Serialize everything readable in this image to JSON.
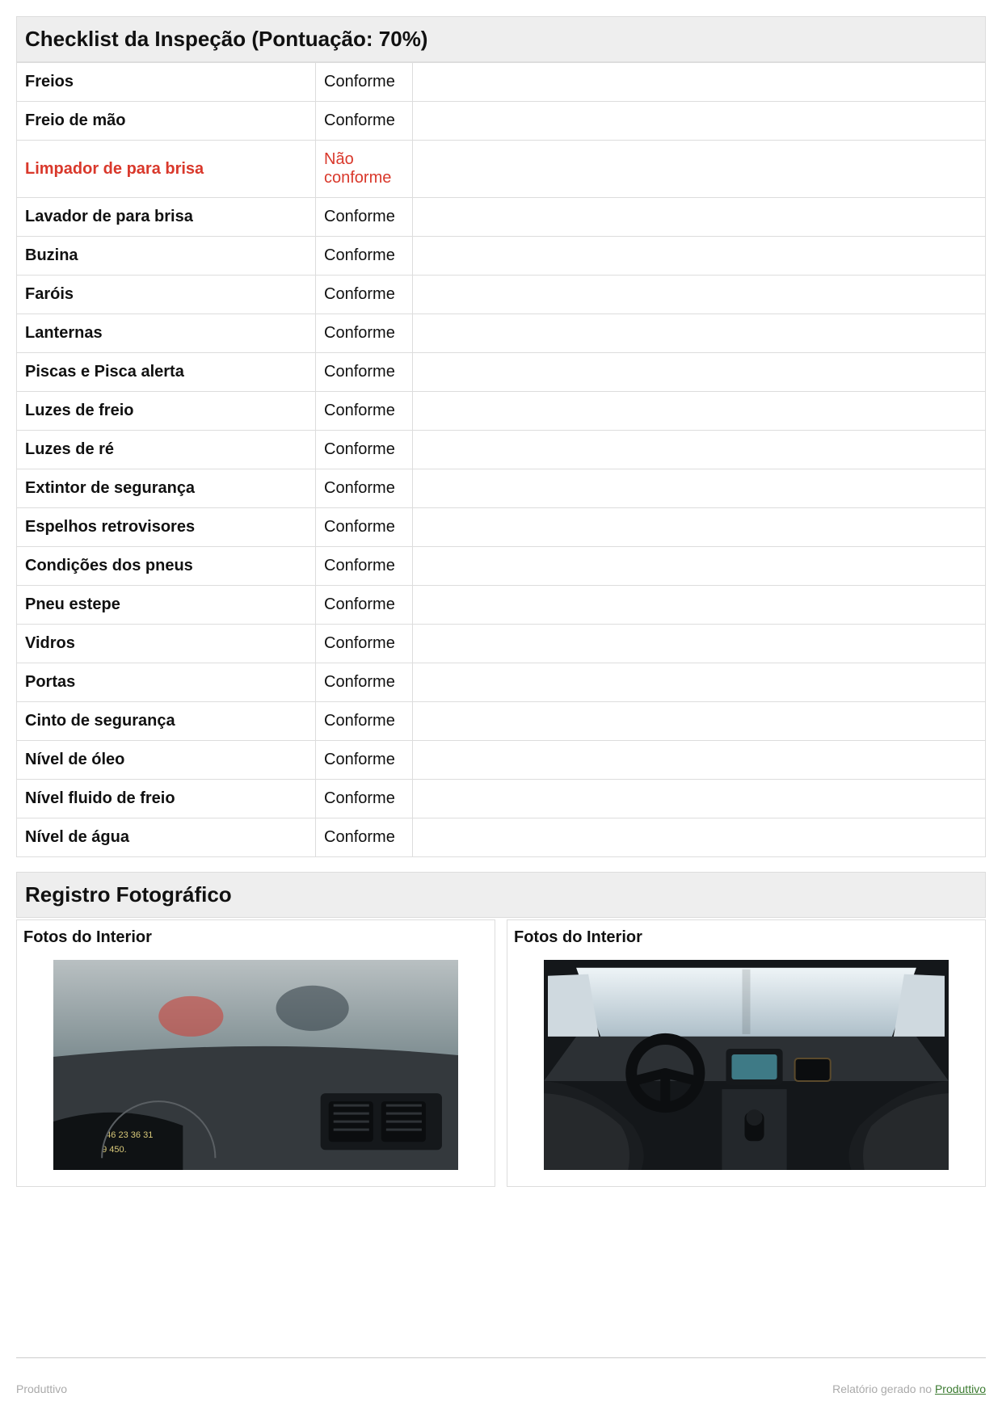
{
  "checklist": {
    "title": "Checklist da Inspeção (Pontuação: 70%)",
    "items": [
      {
        "name": "Freios",
        "status": "Conforme",
        "conforming": true
      },
      {
        "name": "Freio de mão",
        "status": "Conforme",
        "conforming": true
      },
      {
        "name": "Limpador de para brisa",
        "status": "Não conforme",
        "conforming": false
      },
      {
        "name": "Lavador de para brisa",
        "status": "Conforme",
        "conforming": true
      },
      {
        "name": "Buzina",
        "status": "Conforme",
        "conforming": true
      },
      {
        "name": "Faróis",
        "status": "Conforme",
        "conforming": true
      },
      {
        "name": "Lanternas",
        "status": "Conforme",
        "conforming": true
      },
      {
        "name": "Piscas e Pisca alerta",
        "status": "Conforme",
        "conforming": true
      },
      {
        "name": "Luzes de freio",
        "status": "Conforme",
        "conforming": true
      },
      {
        "name": "Luzes de ré",
        "status": "Conforme",
        "conforming": true
      },
      {
        "name": "Extintor de segurança",
        "status": "Conforme",
        "conforming": true
      },
      {
        "name": "Espelhos retrovisores",
        "status": "Conforme",
        "conforming": true
      },
      {
        "name": "Condições dos pneus",
        "status": "Conforme",
        "conforming": true
      },
      {
        "name": "Pneu estepe",
        "status": "Conforme",
        "conforming": true
      },
      {
        "name": "Vidros",
        "status": "Conforme",
        "conforming": true
      },
      {
        "name": "Portas",
        "status": "Conforme",
        "conforming": true
      },
      {
        "name": "Cinto de segurança",
        "status": "Conforme",
        "conforming": true
      },
      {
        "name": "Nível de óleo",
        "status": "Conforme",
        "conforming": true
      },
      {
        "name": "Nível fluido de freio",
        "status": "Conforme",
        "conforming": true
      },
      {
        "name": "Nível de água",
        "status": "Conforme",
        "conforming": true
      }
    ]
  },
  "photos": {
    "title": "Registro Fotográfico",
    "cards": [
      {
        "title": "Fotos do Interior"
      },
      {
        "title": "Fotos do Interior"
      }
    ]
  },
  "footer": {
    "left": "Produttivo",
    "right_prefix": "Relatório gerado no ",
    "right_link": "Produttivo"
  }
}
